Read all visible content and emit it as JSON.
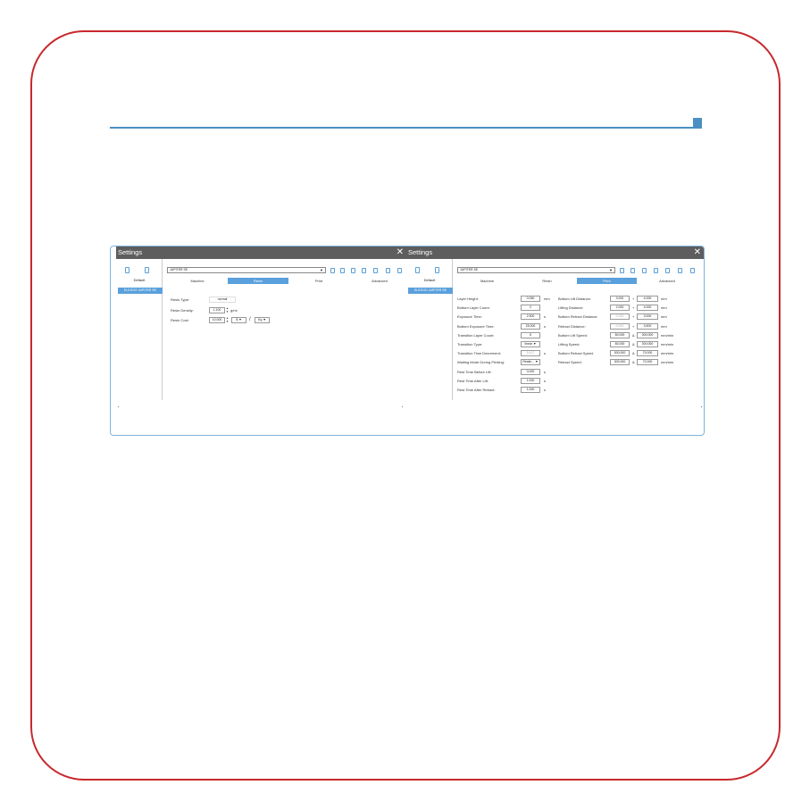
{
  "window_title": "Settings",
  "close_glyph": "✕",
  "sidebar": {
    "default_label": "Default",
    "machine_item": "ELEGOO JUPITER SE"
  },
  "preset": {
    "selected": "JUPITER SE",
    "arrow": "▼"
  },
  "tabs": [
    "Machine",
    "Resin",
    "Print",
    "Advanced"
  ],
  "left_panel": {
    "active_tab": "Resin",
    "resin_type": {
      "label": "Resin Type:",
      "value": "normal"
    },
    "resin_density": {
      "label": "Resin Density:",
      "value": "1.100",
      "unit": "g/ml"
    },
    "resin_cost": {
      "label": "Resin Cost:",
      "value": "10.000",
      "currency": "$",
      "separator": "/",
      "weight_unit": "Kg"
    }
  },
  "right_panel": {
    "active_tab": "Print",
    "left_fields": [
      {
        "label": "Layer Height:",
        "value": "0.050",
        "unit": "mm"
      },
      {
        "label": "Bottom Layer Count:",
        "value": "2",
        "unit": ""
      },
      {
        "label": "Exposure Time:",
        "value": "2.500",
        "unit": "s"
      },
      {
        "label": "Bottom Exposure Time:",
        "value": "25.000",
        "unit": "s"
      },
      {
        "label": "Transition Layer Count:",
        "value": "5",
        "unit": ""
      },
      {
        "label": "Transition Type:",
        "value": "linear ▼",
        "unit": ""
      },
      {
        "label": "Transition Time Decrement:",
        "value": "5.417",
        "unit": "s",
        "dim": true
      },
      {
        "label": "Waiting Mode During Printing:",
        "value": "Restin... ▼",
        "unit": ""
      },
      {
        "label": "Rest Time Before Lift:",
        "value": "0.000",
        "unit": "s"
      },
      {
        "label": "Rest Time After Lift:",
        "value": "1.000",
        "unit": "s"
      },
      {
        "label": "Rest Time After Retract:",
        "value": "1.000",
        "unit": "s"
      }
    ],
    "right_fields": [
      {
        "label": "Bottom Lift Distance:",
        "v1": "3.000",
        "op": "+",
        "v2": "4.000",
        "unit": "mm"
      },
      {
        "label": "Lifting Distance:",
        "v1": "2.000",
        "op": "+",
        "v2": "4.000",
        "unit": "mm"
      },
      {
        "label": "Bottom Retract Distance:",
        "v1": "0.000",
        "op": "+",
        "v2": "3.000",
        "unit": "mm",
        "dim1": true
      },
      {
        "label": "Retract Distance:",
        "v1": "0.000",
        "op": "+",
        "v2": "3.500",
        "unit": "mm",
        "dim1": true
      },
      {
        "label": "Bottom Lift Speed:",
        "v1": "80.000",
        "op": "&",
        "v2": "300.000",
        "unit": "mm/min"
      },
      {
        "label": "Lifting Speed:",
        "v1": "80.000",
        "op": "&",
        "v2": "300.000",
        "unit": "mm/min"
      },
      {
        "label": "Bottom Retract Speed",
        "v1": "300.000",
        "op": "&",
        "v2": "70.000",
        "unit": "mm/min"
      },
      {
        "label": "Retract Speed:",
        "v1": "300.000",
        "op": "&",
        "v2": "70.000",
        "unit": "mm/min"
      }
    ]
  },
  "colors": {
    "accent": "#5aa0dc",
    "frame": "#c8282c",
    "titlebar": "#5d5d5d",
    "rule": "#4a8fc3"
  }
}
